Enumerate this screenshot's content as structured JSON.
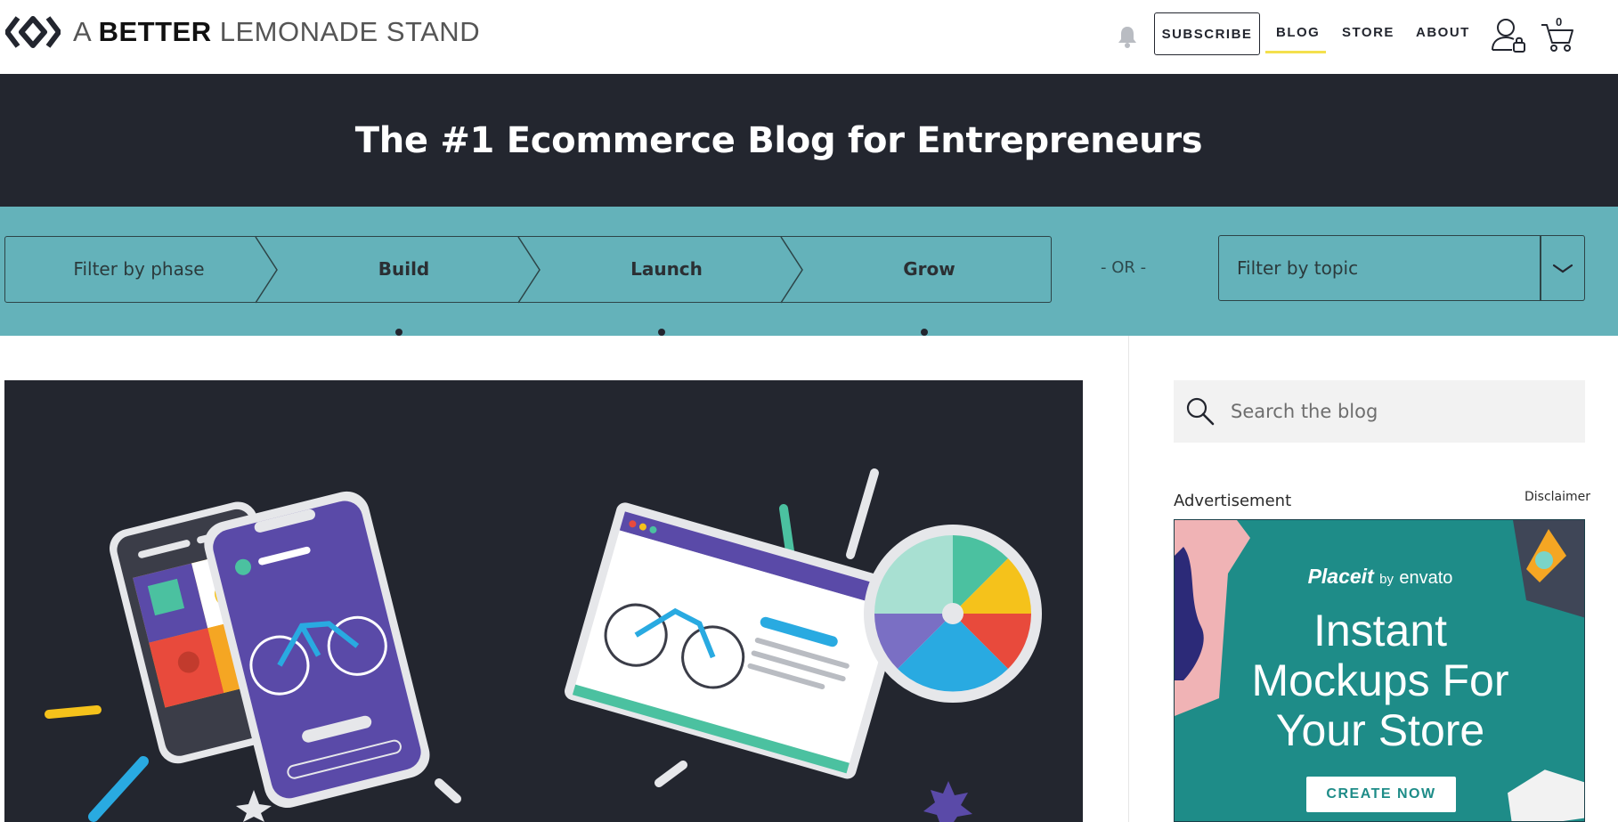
{
  "header": {
    "logo_bold": "A BETTER",
    "logo_light": "LEMONADE STAND",
    "logo_prefix": "A",
    "subscribe_label": "SUBSCRIBE",
    "nav": [
      {
        "label": "BLOG",
        "active": true
      },
      {
        "label": "STORE",
        "active": false
      },
      {
        "label": "ABOUT",
        "active": false
      }
    ],
    "cart_count": "0",
    "icons": [
      "bell-icon",
      "user-lock-icon",
      "cart-icon"
    ]
  },
  "hero": {
    "title": "The #1 Ecommerce Blog for Entrepreneurs"
  },
  "filters": {
    "phase_placeholder": "Filter by phase",
    "phases": [
      "Build",
      "Launch",
      "Grow"
    ],
    "or_text": "- OR -",
    "topic_placeholder": "Filter by topic"
  },
  "sidebar": {
    "search_placeholder": "Search the blog",
    "ad_label": "Advertisement",
    "disclaimer": "Disclaimer",
    "ad": {
      "brand": "Placeit",
      "by": "by",
      "partner": "envato",
      "headline_1": "Instant",
      "headline_2": "Mockups For",
      "headline_3": "Your Store",
      "cta": "CREATE NOW"
    }
  },
  "colors": {
    "dark": "#23262f",
    "teal": "#64b2ba",
    "accent_yellow": "#f4e04d",
    "ad_teal": "#1e8c88"
  }
}
